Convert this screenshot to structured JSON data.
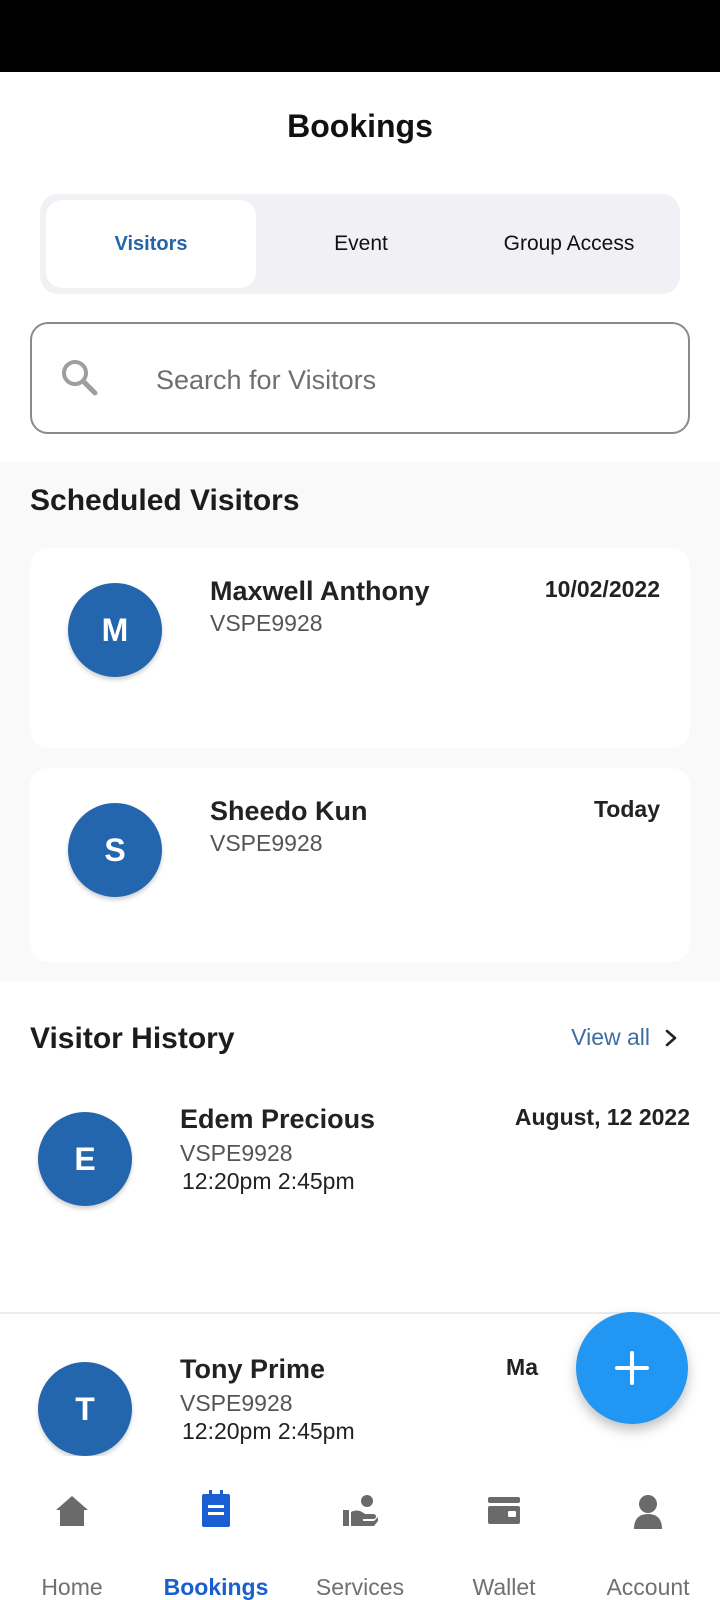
{
  "header": {
    "title": "Bookings"
  },
  "tabs": [
    {
      "label": "Visitors",
      "active": true
    },
    {
      "label": "Event",
      "active": false
    },
    {
      "label": "Group Access",
      "active": false
    }
  ],
  "search": {
    "placeholder": "Search for Visitors",
    "value": "",
    "icon": "search-icon"
  },
  "scheduled": {
    "title": "Scheduled Visitors",
    "items": [
      {
        "initial": "M",
        "name": "Maxwell Anthony",
        "code": "VSPE9928",
        "date": "10/02/2022"
      },
      {
        "initial": "S",
        "name": "Sheedo Kun",
        "code": "VSPE9928",
        "date": "Today"
      }
    ]
  },
  "history": {
    "title": "Visitor History",
    "view_all": "View all",
    "items": [
      {
        "initial": "E",
        "name": "Edem Precious",
        "code": "VSPE9928",
        "times": "12:20pm  2:45pm",
        "date": "August, 12 2022"
      },
      {
        "initial": "T",
        "name": "Tony Prime",
        "code": "VSPE9928",
        "times": "12:20pm  2:45pm",
        "date": "Ma"
      }
    ]
  },
  "fab": {
    "icon": "plus-icon"
  },
  "bottom_nav": [
    {
      "label": "Home",
      "icon": "home-icon",
      "active": false
    },
    {
      "label": "Bookings",
      "icon": "clipboard-icon",
      "active": true
    },
    {
      "label": "Services",
      "icon": "services-icon",
      "active": false
    },
    {
      "label": "Wallet",
      "icon": "wallet-icon",
      "active": false
    },
    {
      "label": "Account",
      "icon": "person-icon",
      "active": false
    }
  ],
  "colors": {
    "accent": "#2366ad",
    "tab_active": "#2366a8",
    "fab": "#2196f3",
    "nav_active": "#1a5fd1",
    "nav_inactive": "#707070"
  }
}
